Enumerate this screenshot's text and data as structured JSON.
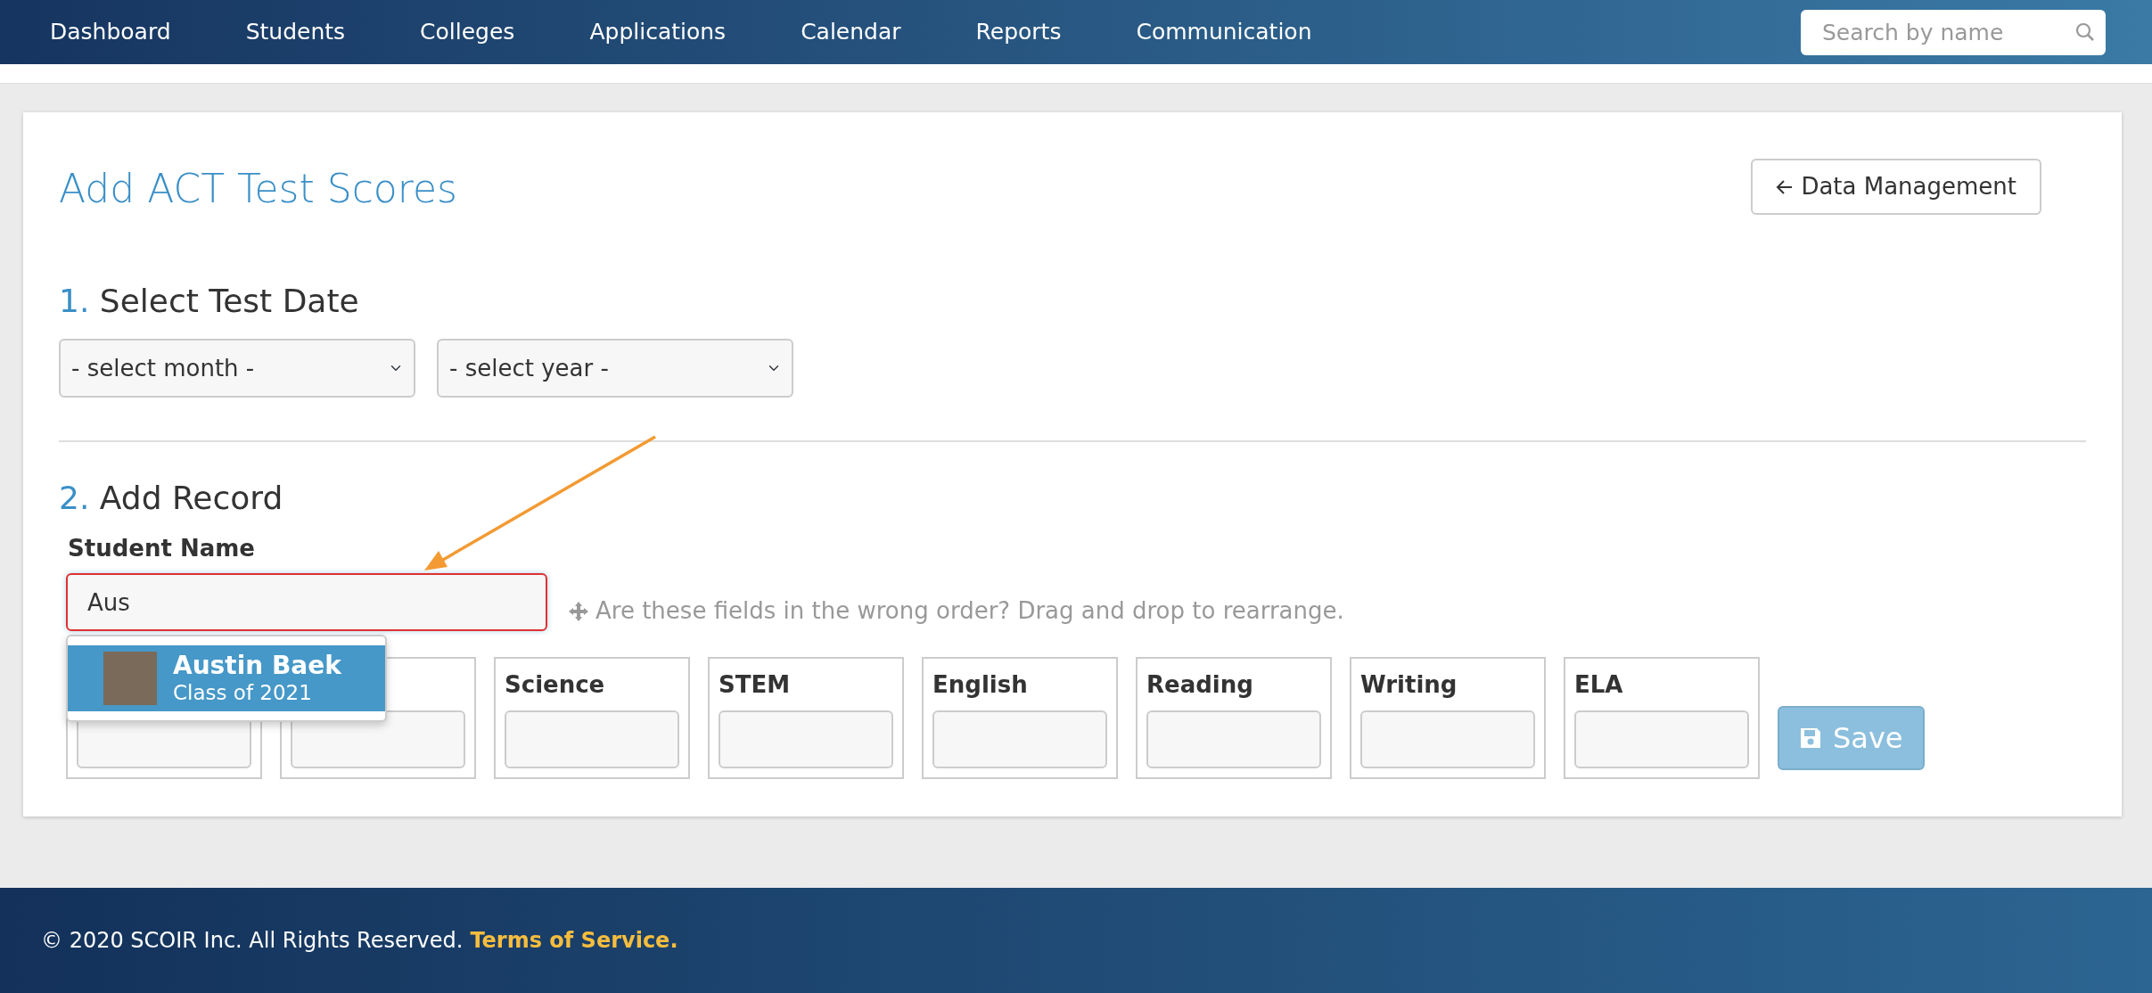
{
  "navbar": {
    "items": [
      {
        "label": "Dashboard"
      },
      {
        "label": "Students"
      },
      {
        "label": "Colleges"
      },
      {
        "label": "Applications"
      },
      {
        "label": "Calendar"
      },
      {
        "label": "Reports"
      },
      {
        "label": "Communication"
      }
    ],
    "search": {
      "placeholder": "Search by name"
    }
  },
  "page": {
    "title": "Add ACT Test Scores",
    "back_button": "Data Management"
  },
  "step1": {
    "number": "1.",
    "title": "Select Test Date",
    "selects": [
      {
        "value": "- select month -"
      },
      {
        "value": "- select year -"
      }
    ]
  },
  "step2": {
    "number": "2.",
    "title": "Add Record",
    "student_label": "Student Name",
    "student_value": "Aus",
    "student_error": true,
    "suggestions": [
      {
        "name": "Austin Baek",
        "subtitle": "Class of 2021",
        "selected": true
      }
    ],
    "hint": "Are these fields in the wrong order? Drag and drop to rearrange.",
    "score_fields": [
      {
        "kind": "covered"
      },
      {
        "kind": "covered"
      },
      {
        "kind": "labeled",
        "label": "Science"
      },
      {
        "kind": "labeled",
        "label": "STEM"
      },
      {
        "kind": "labeled",
        "label": "English"
      },
      {
        "kind": "labeled",
        "label": "Reading"
      },
      {
        "kind": "labeled",
        "label": "Writing"
      },
      {
        "kind": "labeled",
        "label": "ELA"
      }
    ],
    "save_button": {
      "label": "Save",
      "disabled": true
    }
  },
  "footer": {
    "text": "© 2020 SCOIR Inc. All Rights Reserved.",
    "link": "Terms of Service."
  }
}
